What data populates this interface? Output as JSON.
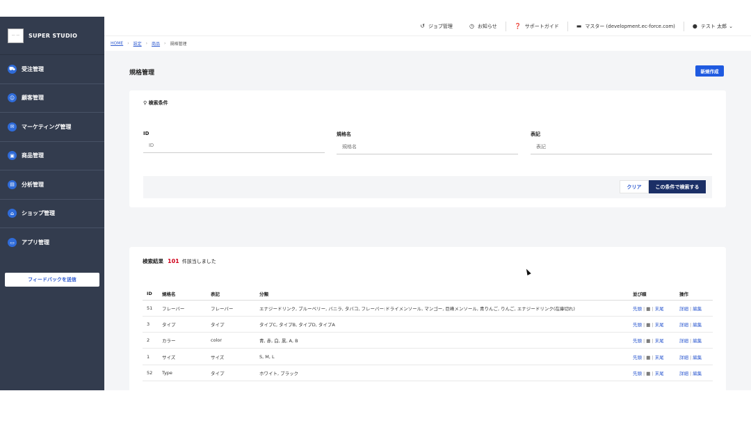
{
  "brand": {
    "name": "SUPER STUDIO",
    "logo_text": "— —"
  },
  "sidebar": {
    "items": [
      {
        "label": "受注管理",
        "icon": "cart-icon",
        "glyph": "⛟"
      },
      {
        "label": "顧客管理",
        "icon": "user-icon",
        "glyph": "☺"
      },
      {
        "label": "マーケティング管理",
        "icon": "mail-icon",
        "glyph": "✉"
      },
      {
        "label": "商品管理",
        "icon": "box-icon",
        "glyph": "▣"
      },
      {
        "label": "分析管理",
        "icon": "chart-icon",
        "glyph": "▤"
      },
      {
        "label": "ショップ管理",
        "icon": "shop-icon",
        "glyph": "⌂"
      },
      {
        "label": "アプリ管理",
        "icon": "app-icon",
        "glyph": "▭"
      }
    ],
    "feedback_label": "フィードバックを送信"
  },
  "topbar": {
    "job_label": "ジョブ管理",
    "notice_label": "お知らせ",
    "support_label": "サポートガイド",
    "master_label": "マスター (development.ec-force.com)",
    "user_label": "テスト 太郎"
  },
  "breadcrumb": {
    "home": "HOME",
    "settings": "設定",
    "product": "商品",
    "current": "規格管理"
  },
  "page": {
    "title": "規格管理",
    "new_button": "新規作成"
  },
  "search": {
    "heading": "検索条件",
    "fields": [
      {
        "label": "ID",
        "placeholder": "ID"
      },
      {
        "label": "規格名",
        "placeholder": "規格名"
      },
      {
        "label": "表記",
        "placeholder": "表記"
      }
    ],
    "clear_label": "クリア",
    "submit_label": "この条件で検索する"
  },
  "results": {
    "label": "検索結果",
    "count": "101",
    "suffix": "件該当しました",
    "columns": [
      "ID",
      "規格名",
      "表記",
      "分類",
      "並び順",
      "操作"
    ],
    "sort_labels": {
      "first": "先頭",
      "last": "末尾"
    },
    "action_labels": {
      "detail": "詳細",
      "edit": "編集"
    },
    "rows": [
      {
        "id": "51",
        "name": "フレーバー",
        "display": "フレーバー",
        "categories": "エナジードリンク, ブルーベリー, バニラ, タバコ, フレーバー:ドライメンソール, マンゴー, 巨峰メンソール, 青りんご, りんご, エナジードリンク(在庫切れ)"
      },
      {
        "id": "3",
        "name": "タイプ",
        "display": "タイプ",
        "categories": "タイプC, タイプB, タイプD, タイプA"
      },
      {
        "id": "2",
        "name": "カラー",
        "display": "color",
        "categories": "青, 赤, 白, 黒, A, B"
      },
      {
        "id": "1",
        "name": "サイズ",
        "display": "サイズ",
        "categories": "S, M, L"
      },
      {
        "id": "52",
        "name": "Type",
        "display": "タイプ",
        "categories": "ホワイト, ブラック"
      }
    ]
  }
}
